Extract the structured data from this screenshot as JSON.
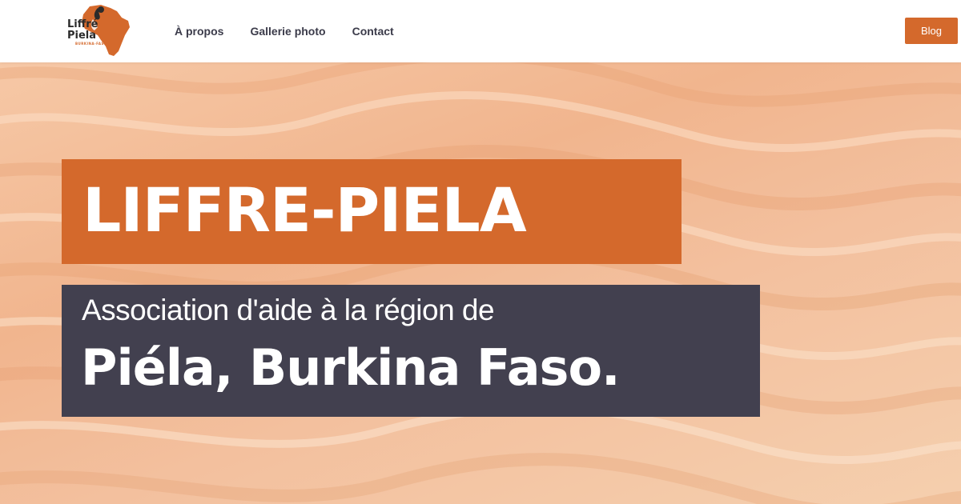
{
  "logo": {
    "line1": "Liffré",
    "line2": "Piela",
    "sub": "BURKINA-FASO"
  },
  "nav": {
    "items": [
      {
        "label": "À propos"
      },
      {
        "label": "Gallerie photo"
      },
      {
        "label": "Contact"
      }
    ],
    "blog_label": "Blog"
  },
  "hero": {
    "title": "LIFFRE-PIELA",
    "subtitle_line1": "Association d'aide à la région de",
    "subtitle_line2": "Piéla, Burkina Faso."
  },
  "colors": {
    "accent": "#d4692c",
    "dark_box": "#42404f",
    "nav_text": "#3b3b4a",
    "sand": "#f3c09e"
  },
  "icons": {
    "logo": "africa-map-with-figure-icon"
  }
}
